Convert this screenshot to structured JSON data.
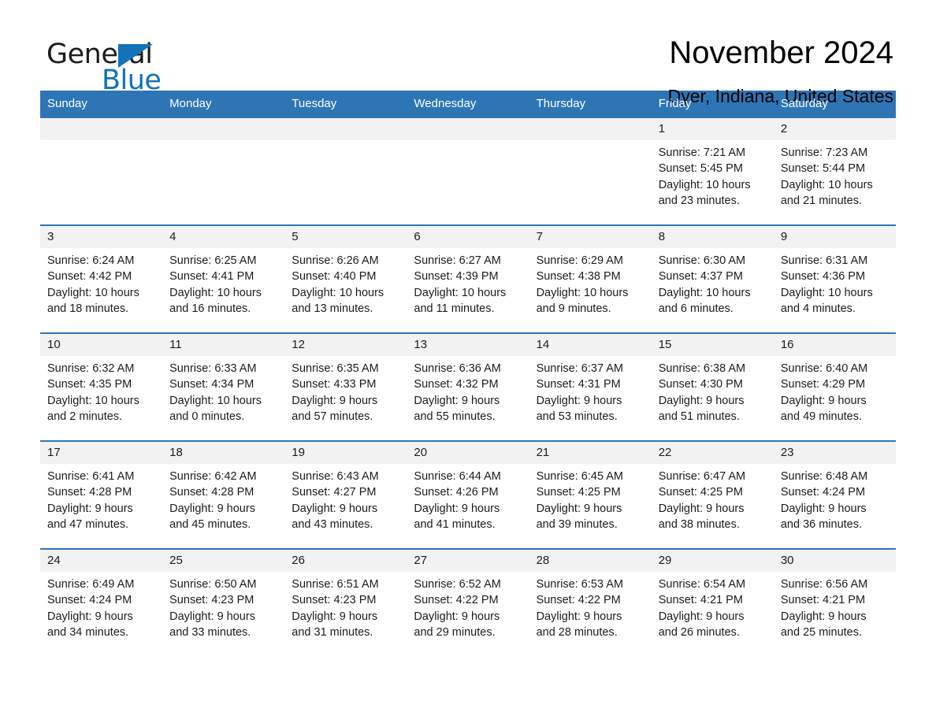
{
  "brand": {
    "word_one": "General",
    "word_two": "Blue",
    "triangle_icon": "brand-triangle-icon",
    "accent_color": "#1273b8"
  },
  "header": {
    "month_title": "November 2024",
    "location": "Dyer, Indiana, United States"
  },
  "theme": {
    "header_blue": "#2e75b6",
    "daynum_band": "#f2f2f2",
    "text": "#1c1c1c"
  },
  "calendar": {
    "weekdays": [
      "Sunday",
      "Monday",
      "Tuesday",
      "Wednesday",
      "Thursday",
      "Friday",
      "Saturday"
    ],
    "weeks": [
      [
        {
          "day": "",
          "lines": []
        },
        {
          "day": "",
          "lines": []
        },
        {
          "day": "",
          "lines": []
        },
        {
          "day": "",
          "lines": []
        },
        {
          "day": "",
          "lines": []
        },
        {
          "day": "1",
          "lines": [
            "Sunrise: 7:21 AM",
            "Sunset: 5:45 PM",
            "Daylight: 10 hours",
            "and 23 minutes."
          ]
        },
        {
          "day": "2",
          "lines": [
            "Sunrise: 7:23 AM",
            "Sunset: 5:44 PM",
            "Daylight: 10 hours",
            "and 21 minutes."
          ]
        }
      ],
      [
        {
          "day": "3",
          "lines": [
            "Sunrise: 6:24 AM",
            "Sunset: 4:42 PM",
            "Daylight: 10 hours",
            "and 18 minutes."
          ]
        },
        {
          "day": "4",
          "lines": [
            "Sunrise: 6:25 AM",
            "Sunset: 4:41 PM",
            "Daylight: 10 hours",
            "and 16 minutes."
          ]
        },
        {
          "day": "5",
          "lines": [
            "Sunrise: 6:26 AM",
            "Sunset: 4:40 PM",
            "Daylight: 10 hours",
            "and 13 minutes."
          ]
        },
        {
          "day": "6",
          "lines": [
            "Sunrise: 6:27 AM",
            "Sunset: 4:39 PM",
            "Daylight: 10 hours",
            "and 11 minutes."
          ]
        },
        {
          "day": "7",
          "lines": [
            "Sunrise: 6:29 AM",
            "Sunset: 4:38 PM",
            "Daylight: 10 hours",
            "and 9 minutes."
          ]
        },
        {
          "day": "8",
          "lines": [
            "Sunrise: 6:30 AM",
            "Sunset: 4:37 PM",
            "Daylight: 10 hours",
            "and 6 minutes."
          ]
        },
        {
          "day": "9",
          "lines": [
            "Sunrise: 6:31 AM",
            "Sunset: 4:36 PM",
            "Daylight: 10 hours",
            "and 4 minutes."
          ]
        }
      ],
      [
        {
          "day": "10",
          "lines": [
            "Sunrise: 6:32 AM",
            "Sunset: 4:35 PM",
            "Daylight: 10 hours",
            "and 2 minutes."
          ]
        },
        {
          "day": "11",
          "lines": [
            "Sunrise: 6:33 AM",
            "Sunset: 4:34 PM",
            "Daylight: 10 hours",
            "and 0 minutes."
          ]
        },
        {
          "day": "12",
          "lines": [
            "Sunrise: 6:35 AM",
            "Sunset: 4:33 PM",
            "Daylight: 9 hours",
            "and 57 minutes."
          ]
        },
        {
          "day": "13",
          "lines": [
            "Sunrise: 6:36 AM",
            "Sunset: 4:32 PM",
            "Daylight: 9 hours",
            "and 55 minutes."
          ]
        },
        {
          "day": "14",
          "lines": [
            "Sunrise: 6:37 AM",
            "Sunset: 4:31 PM",
            "Daylight: 9 hours",
            "and 53 minutes."
          ]
        },
        {
          "day": "15",
          "lines": [
            "Sunrise: 6:38 AM",
            "Sunset: 4:30 PM",
            "Daylight: 9 hours",
            "and 51 minutes."
          ]
        },
        {
          "day": "16",
          "lines": [
            "Sunrise: 6:40 AM",
            "Sunset: 4:29 PM",
            "Daylight: 9 hours",
            "and 49 minutes."
          ]
        }
      ],
      [
        {
          "day": "17",
          "lines": [
            "Sunrise: 6:41 AM",
            "Sunset: 4:28 PM",
            "Daylight: 9 hours",
            "and 47 minutes."
          ]
        },
        {
          "day": "18",
          "lines": [
            "Sunrise: 6:42 AM",
            "Sunset: 4:28 PM",
            "Daylight: 9 hours",
            "and 45 minutes."
          ]
        },
        {
          "day": "19",
          "lines": [
            "Sunrise: 6:43 AM",
            "Sunset: 4:27 PM",
            "Daylight: 9 hours",
            "and 43 minutes."
          ]
        },
        {
          "day": "20",
          "lines": [
            "Sunrise: 6:44 AM",
            "Sunset: 4:26 PM",
            "Daylight: 9 hours",
            "and 41 minutes."
          ]
        },
        {
          "day": "21",
          "lines": [
            "Sunrise: 6:45 AM",
            "Sunset: 4:25 PM",
            "Daylight: 9 hours",
            "and 39 minutes."
          ]
        },
        {
          "day": "22",
          "lines": [
            "Sunrise: 6:47 AM",
            "Sunset: 4:25 PM",
            "Daylight: 9 hours",
            "and 38 minutes."
          ]
        },
        {
          "day": "23",
          "lines": [
            "Sunrise: 6:48 AM",
            "Sunset: 4:24 PM",
            "Daylight: 9 hours",
            "and 36 minutes."
          ]
        }
      ],
      [
        {
          "day": "24",
          "lines": [
            "Sunrise: 6:49 AM",
            "Sunset: 4:24 PM",
            "Daylight: 9 hours",
            "and 34 minutes."
          ]
        },
        {
          "day": "25",
          "lines": [
            "Sunrise: 6:50 AM",
            "Sunset: 4:23 PM",
            "Daylight: 9 hours",
            "and 33 minutes."
          ]
        },
        {
          "day": "26",
          "lines": [
            "Sunrise: 6:51 AM",
            "Sunset: 4:23 PM",
            "Daylight: 9 hours",
            "and 31 minutes."
          ]
        },
        {
          "day": "27",
          "lines": [
            "Sunrise: 6:52 AM",
            "Sunset: 4:22 PM",
            "Daylight: 9 hours",
            "and 29 minutes."
          ]
        },
        {
          "day": "28",
          "lines": [
            "Sunrise: 6:53 AM",
            "Sunset: 4:22 PM",
            "Daylight: 9 hours",
            "and 28 minutes."
          ]
        },
        {
          "day": "29",
          "lines": [
            "Sunrise: 6:54 AM",
            "Sunset: 4:21 PM",
            "Daylight: 9 hours",
            "and 26 minutes."
          ]
        },
        {
          "day": "30",
          "lines": [
            "Sunrise: 6:56 AM",
            "Sunset: 4:21 PM",
            "Daylight: 9 hours",
            "and 25 minutes."
          ]
        }
      ]
    ]
  }
}
